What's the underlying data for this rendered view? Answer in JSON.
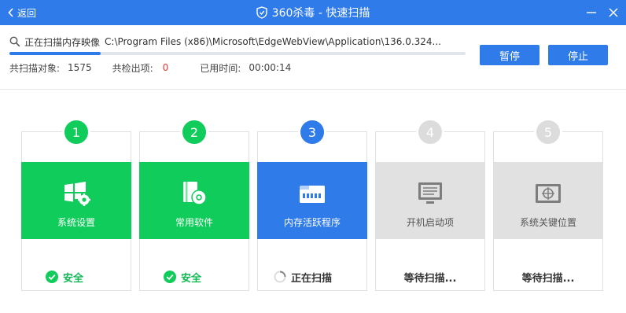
{
  "titlebar": {
    "back_label": "返回",
    "title": "360杀毒 - 快速扫描"
  },
  "scan": {
    "status_label": "正在扫描内存映像",
    "current_path": "C:\\Program Files (x86)\\Microsoft\\EdgeWebView\\Application\\136.0.324...",
    "progress": 0.2,
    "objects_label": "共扫描对象:",
    "objects_value": "1575",
    "detected_label": "共检出项:",
    "detected_value": "0",
    "elapsed_label": "已用时间:",
    "elapsed_value": "00:00:14"
  },
  "buttons": {
    "pause": "暂停",
    "stop": "停止"
  },
  "steps": [
    {
      "num": "1",
      "label": "系统设置",
      "status": "安全",
      "state": "done",
      "icon": "windows-gear-icon"
    },
    {
      "num": "2",
      "label": "常用软件",
      "status": "安全",
      "state": "done",
      "icon": "software-disc-icon"
    },
    {
      "num": "3",
      "label": "内存活跃程序",
      "status": "正在扫描",
      "state": "scanning",
      "icon": "memory-chip-icon"
    },
    {
      "num": "4",
      "label": "开机启动项",
      "status": "等待扫描...",
      "state": "waiting",
      "icon": "monitor-list-icon"
    },
    {
      "num": "5",
      "label": "系统关键位置",
      "status": "等待扫描...",
      "state": "waiting",
      "icon": "target-crosshair-icon"
    }
  ],
  "colors": {
    "brand_blue": "#2f7be9",
    "safe_green": "#10cc5b",
    "pending_gray": "#e1e1e1",
    "alert_red": "#e53935"
  }
}
